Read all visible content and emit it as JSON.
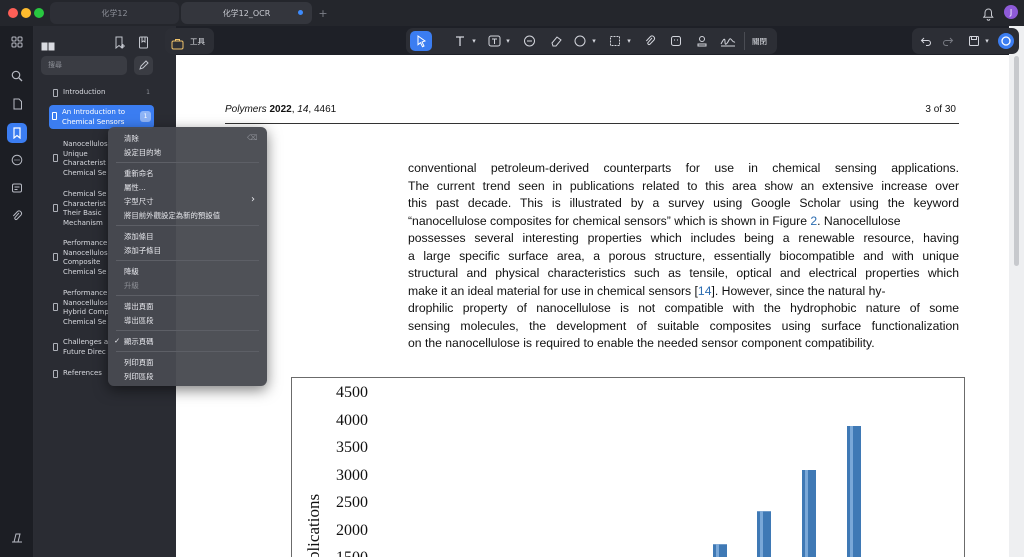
{
  "window": {
    "tabs": [
      {
        "label": "化学12"
      },
      {
        "label": "化学12_OCR"
      }
    ],
    "new_tab": "+",
    "avatar": "J"
  },
  "rail": {
    "icons": [
      "grid-icon",
      "search-icon",
      "document-icon",
      "bookmark-icon",
      "comment-icon",
      "form-icon",
      "attachment-icon",
      "layers-icon"
    ]
  },
  "sidebar": {
    "search_placeholder": "搜尋",
    "items": [
      {
        "label": "Introduction",
        "badge": "1"
      },
      {
        "label": "An Introduction to\nChemical Sensors",
        "badge": "1"
      },
      {
        "label": "Nanocellulos\nUnique\nCharacterist\nChemical Se"
      },
      {
        "label": "Chemical Se\nCharacterist\nTheir Basic\nMechanism"
      },
      {
        "label": "Performance\nNanocellulos\nComposite\nChemical Se"
      },
      {
        "label": "Performance\nNanocellulos\nHybrid Comp\nChemical Se"
      },
      {
        "label": "Challenges a\nFuture Direc"
      },
      {
        "label": "References"
      }
    ]
  },
  "toolbar": {
    "tools_label": "工具",
    "close_label": "關閉"
  },
  "context_menu": {
    "items": [
      {
        "label": "清除",
        "shortcut": "⌫"
      },
      {
        "label": "設定目的地"
      },
      {
        "label": "重新命名"
      },
      {
        "label": "屬性..."
      },
      {
        "label": "字型尺寸",
        "submenu": "›"
      },
      {
        "label": "將目前外觀設定為新的預設值"
      },
      {
        "label": "添加條目"
      },
      {
        "label": "添加子條目"
      },
      {
        "label": "降級"
      },
      {
        "label": "升級",
        "disabled": true
      },
      {
        "label": "導出頁面"
      },
      {
        "label": "導出區段"
      },
      {
        "label": "顯示頁碼",
        "checked": "✓"
      },
      {
        "label": "列印頁面"
      },
      {
        "label": "列印區段"
      }
    ]
  },
  "document": {
    "header_journal": "Polymers",
    "header_year": "2022",
    "header_volume": "14",
    "header_article": "4461",
    "header_sep1": ",",
    "header_sep2": ",",
    "page_indicator": "3 of 30",
    "paragraph": [
      "conventional petroleum-derived counterparts for use in chemical sensing applications.",
      "The current trend seen in publications related to this area show an extensive increase over",
      "this past decade. This is illustrated by a survey using Google Scholar using the keyword",
      "“nanocellulose composites for chemical sensors” which is shown in Figure ",
      "2",
      ". Nanocellulose",
      "possesses several interesting properties which includes being a renewable resource, having",
      "a large specific surface area, a porous structure, essentially biocompatible and with unique",
      "structural and physical characteristics such as tensile, optical and electrical properties which",
      "make it an ideal material for use in chemical sensors [",
      "14",
      "]. However, since the natural hy-",
      "drophilic property of nanocellulose is not compatible with the hydrophobic nature of some",
      "sensing molecules, the development of suitable composites using surface functionalization",
      "on the nanocellulose is required to enable the needed sensor component compatibility."
    ]
  },
  "chart_data": {
    "type": "bar",
    "ylabel": "Publications",
    "yticks": [
      "4500",
      "4000",
      "3500",
      "3000",
      "2500",
      "2000",
      "1500"
    ],
    "ylim": [
      1500,
      4500
    ],
    "values": [
      1750,
      2350,
      3100,
      3900
    ],
    "bar_color": "#3f79b5",
    "grid": false
  }
}
